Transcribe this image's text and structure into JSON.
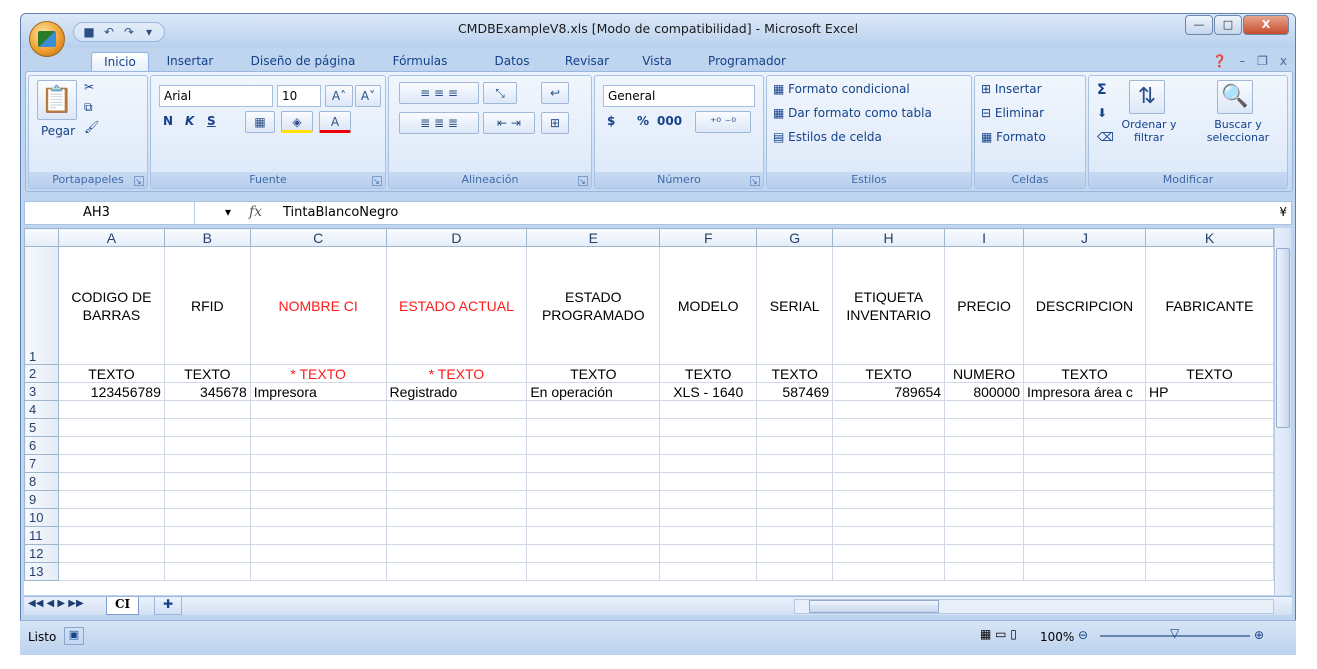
{
  "window": {
    "title": "CMDBExampleV8.xls  [Modo de compatibilidad] - Microsoft Excel",
    "min": "—",
    "max": "□",
    "close": "X"
  },
  "tabs": [
    "Inicio",
    "Insertar",
    "Diseño de página",
    "Fórmulas",
    "Datos",
    "Revisar",
    "Vista",
    "Programador"
  ],
  "ribbon": {
    "clipboard": {
      "paste": "Pegar",
      "label": "Portapapeles"
    },
    "font": {
      "name": "Arial",
      "size": "10",
      "bold": "N",
      "italic": "K",
      "underline": "S",
      "label": "Fuente"
    },
    "align": {
      "label": "Alineación"
    },
    "number": {
      "format": "General",
      "currency": "$",
      "percent": "%",
      "thousands": "000",
      "label": "Número"
    },
    "styles": {
      "cond": "Formato condicional",
      "table": "Dar formato como tabla",
      "cell": "Estilos de celda",
      "label": "Estilos"
    },
    "cells": {
      "insert": "Insertar",
      "delete": "Eliminar",
      "format": "Formato",
      "label": "Celdas"
    },
    "edit": {
      "sum": "Σ",
      "sort": "Ordenar y filtrar",
      "find": "Buscar y seleccionar",
      "label": "Modificar"
    }
  },
  "formula": {
    "namebox": "AH3",
    "fx": "fx",
    "value": "TintaBlancoNegro"
  },
  "columns": [
    "A",
    "B",
    "C",
    "D",
    "E",
    "F",
    "G",
    "H",
    "I",
    "J",
    "K"
  ],
  "rows": [
    {
      "n": "1",
      "cells": [
        "CODIGO DE BARRAS",
        "RFID",
        "NOMBRE CI",
        "ESTADO ACTUAL",
        "ESTADO PROGRAMADO",
        "MODELO",
        "SERIAL",
        "ETIQUETA INVENTARIO",
        "PRECIO",
        "DESCRIPCION",
        "FABRICANTE"
      ]
    },
    {
      "n": "2",
      "cells": [
        "TEXTO",
        "TEXTO",
        "* TEXTO",
        "* TEXTO",
        "TEXTO",
        "TEXTO",
        "TEXTO",
        "TEXTO",
        "NUMERO",
        "TEXTO",
        "TEXTO"
      ]
    },
    {
      "n": "3",
      "cells": [
        "123456789",
        "345678",
        "Impresora",
        "Registrado",
        "En operación",
        "XLS - 1640",
        "587469",
        "789654",
        "800000",
        "Impresora área c",
        "HP"
      ]
    },
    {
      "n": "4",
      "cells": []
    },
    {
      "n": "5",
      "cells": []
    },
    {
      "n": "6",
      "cells": []
    },
    {
      "n": "7",
      "cells": []
    },
    {
      "n": "8",
      "cells": []
    },
    {
      "n": "9",
      "cells": []
    },
    {
      "n": "10",
      "cells": []
    },
    {
      "n": "11",
      "cells": []
    },
    {
      "n": "12",
      "cells": []
    },
    {
      "n": "13",
      "cells": []
    }
  ],
  "sheet": {
    "tab": "CI"
  },
  "status": {
    "ready": "Listo",
    "zoom": "100%"
  }
}
